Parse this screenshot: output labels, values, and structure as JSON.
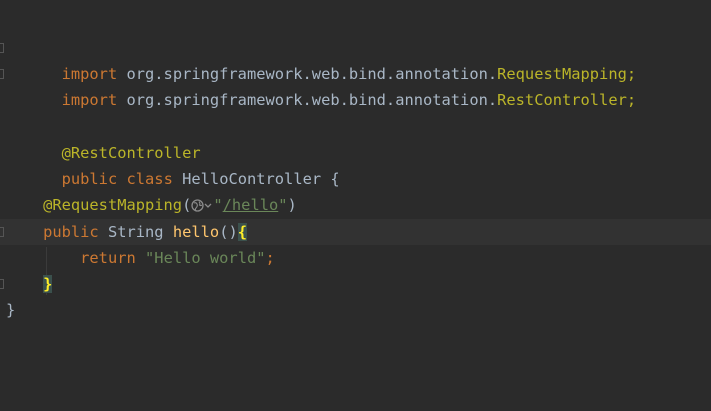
{
  "editor": {
    "line1": {
      "keyword": "import",
      "package": " org.springframework.web.bind.annotation.",
      "class": "RequestMapping;"
    },
    "line2": {
      "keyword": "import",
      "package": " org.springframework.web.bind.annotation.",
      "class": "RestController;"
    },
    "line4": {
      "annotation": "@RestController"
    },
    "line5": {
      "kw1": "public",
      "kw2": "class",
      "name": "HelloController",
      "brace": "{"
    },
    "line7": {
      "annotation": "@RequestMapping",
      "paren_open": "(",
      "quote_open": "\"",
      "path": "/hello",
      "quote_close": "\"",
      "paren_close": ")"
    },
    "line8": {
      "kw": "public",
      "type": "String",
      "method": "hello",
      "parens": "()",
      "brace": "{"
    },
    "line9": {
      "kw": "return",
      "string": "\"Hello world\"",
      "semicolon": ";"
    },
    "line10": {
      "brace": "}"
    },
    "line11": {
      "brace": "}"
    },
    "icons": {
      "endpoint_icon": "globe-icon",
      "endpoint_dropdown": "chevron-down-icon"
    },
    "colors": {
      "background": "#2b2b2b",
      "current_line": "#323232",
      "keyword": "#cc7832",
      "annotation": "#bbb529",
      "string": "#6a8759",
      "method": "#ffc66d",
      "text": "#a9b7c6",
      "brace_match": "#ffef28"
    }
  }
}
